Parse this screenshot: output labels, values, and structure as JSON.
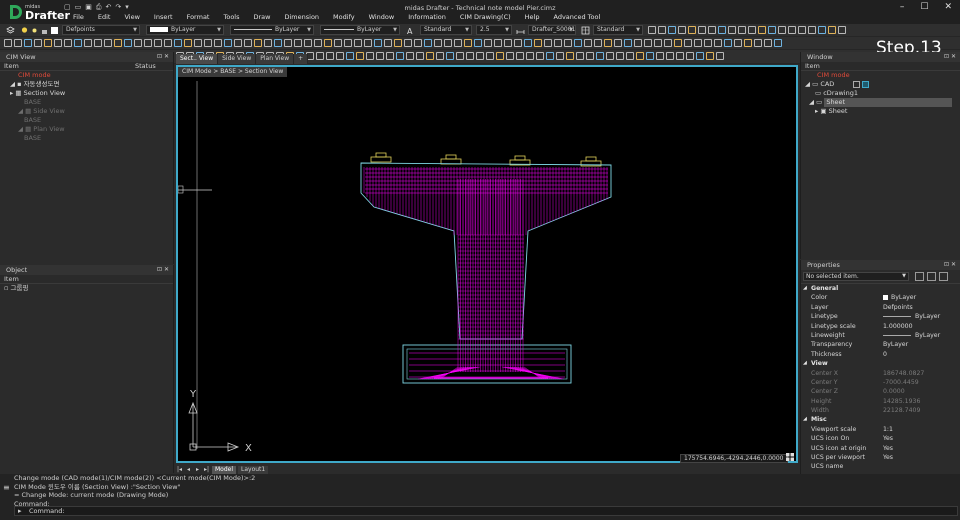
{
  "app": {
    "brand_small": "midas",
    "brand": "Drafter",
    "window_title": "midas Drafter - Technical note model Pier.cimz",
    "step_label": "Step.13"
  },
  "menu": [
    "File",
    "Edit",
    "View",
    "Insert",
    "Format",
    "Tools",
    "Draw",
    "Dimension",
    "Modify",
    "Window",
    "Information",
    "CIM Drawing(C)",
    "Help",
    "Advanced Tool"
  ],
  "toolbar": {
    "layer": "Defpoints",
    "color": "ByLayer",
    "linetype": "ByLayer",
    "lineweight": "ByLayer",
    "text_style": "Standard",
    "text_height": "2.5",
    "dim_style": "Drafter_S0001",
    "table_style": "Standard"
  },
  "cim_view": {
    "title": "CIM View",
    "col_item": "Item",
    "col_status": "Status",
    "mode": "CIM mode",
    "items": [
      {
        "label": "자동생성도면",
        "muted": false
      },
      {
        "label": "Section View",
        "muted": false
      },
      {
        "label": "BASE",
        "muted": true
      },
      {
        "label": "Side View",
        "muted": true
      },
      {
        "label": "BASE",
        "muted": true
      },
      {
        "label": "Plan View",
        "muted": true
      },
      {
        "label": "BASE",
        "muted": true
      }
    ]
  },
  "object_panel": {
    "title": "Object",
    "col_item": "Item",
    "items": [
      "그룹핑"
    ]
  },
  "tabs": [
    "Sect.. View",
    "Side View",
    "Plan View",
    "+"
  ],
  "breadcrumb": "CIM Mode > BASE > Section View",
  "coord_readout": "175754.6946,-4294.2446,0.0000",
  "ucs": {
    "x_label": "X",
    "y_label": "Y"
  },
  "layout_tabs": [
    "Model",
    "Layout1"
  ],
  "window_panel": {
    "title": "Window",
    "col_item": "Item",
    "mode": "CIM mode",
    "items": [
      "CAD",
      "cDrawing1",
      "Sheet",
      "Sheet"
    ]
  },
  "properties": {
    "title": "Properties",
    "selection": "No selected item.",
    "general_title": "General",
    "general": [
      {
        "k": "Color",
        "v": "ByLayer"
      },
      {
        "k": "Layer",
        "v": "Defpoints"
      },
      {
        "k": "Linetype",
        "v": "ByLayer"
      },
      {
        "k": "Linetype scale",
        "v": "1.000000"
      },
      {
        "k": "Lineweight",
        "v": "ByLayer"
      },
      {
        "k": "Transparency",
        "v": "ByLayer"
      },
      {
        "k": "Thickness",
        "v": "0"
      }
    ],
    "view_title": "View",
    "view": [
      {
        "k": "Center X",
        "v": "186748.0827"
      },
      {
        "k": "Center Y",
        "v": "-7000.4459"
      },
      {
        "k": "Center Z",
        "v": "0.0000"
      },
      {
        "k": "Height",
        "v": "14285.1936"
      },
      {
        "k": "Width",
        "v": "22128.7409"
      }
    ],
    "misc_title": "Misc",
    "misc": [
      {
        "k": "Viewport scale",
        "v": "1:1"
      },
      {
        "k": "UCS icon On",
        "v": "Yes"
      },
      {
        "k": "UCS icon at origin",
        "v": "Yes"
      },
      {
        "k": "UCS per viewport",
        "v": "Yes"
      },
      {
        "k": "UCS name",
        "v": ""
      }
    ]
  },
  "command": {
    "lines": [
      "Change mode (CAD mode(1)/CIM mode(2)) <Current mode(CIM Mode)>:2",
      "CIM Mode 윈도우 이름 (Section View) :\"Section View\"",
      "= Change Mode: current mode (Drawing Mode)",
      "Command:"
    ],
    "prompt": "Command:"
  },
  "colors": {
    "accent": "#3fa9c9",
    "drawing_magenta": "#ff00ff",
    "drawing_outline": "#7fd8e6",
    "bearing_yellow": "#e3d35a"
  }
}
